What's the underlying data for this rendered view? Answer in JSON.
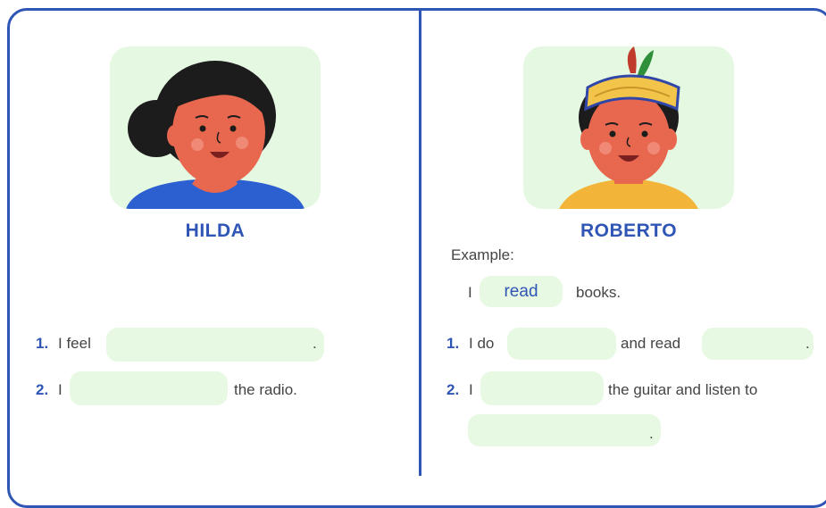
{
  "left": {
    "name": "HILDA",
    "items": [
      {
        "num": "1.",
        "before": "I feel",
        "after": "."
      },
      {
        "num": "2.",
        "before": "I",
        "after": "the radio."
      }
    ]
  },
  "right": {
    "name": "ROBERTO",
    "example_label": "Example:",
    "example": {
      "before": "I",
      "answer": "read",
      "after": "books."
    },
    "items": [
      {
        "num": "1.",
        "before": "I do",
        "middle": "and read",
        "after": "."
      },
      {
        "num": "2.",
        "before": "I",
        "middle": "the guitar and listen to",
        "after": "."
      }
    ]
  },
  "colors": {
    "accent": "#2f55b5",
    "blank": "#e7f8e3",
    "portrait_bg": "#e5f8e1"
  }
}
